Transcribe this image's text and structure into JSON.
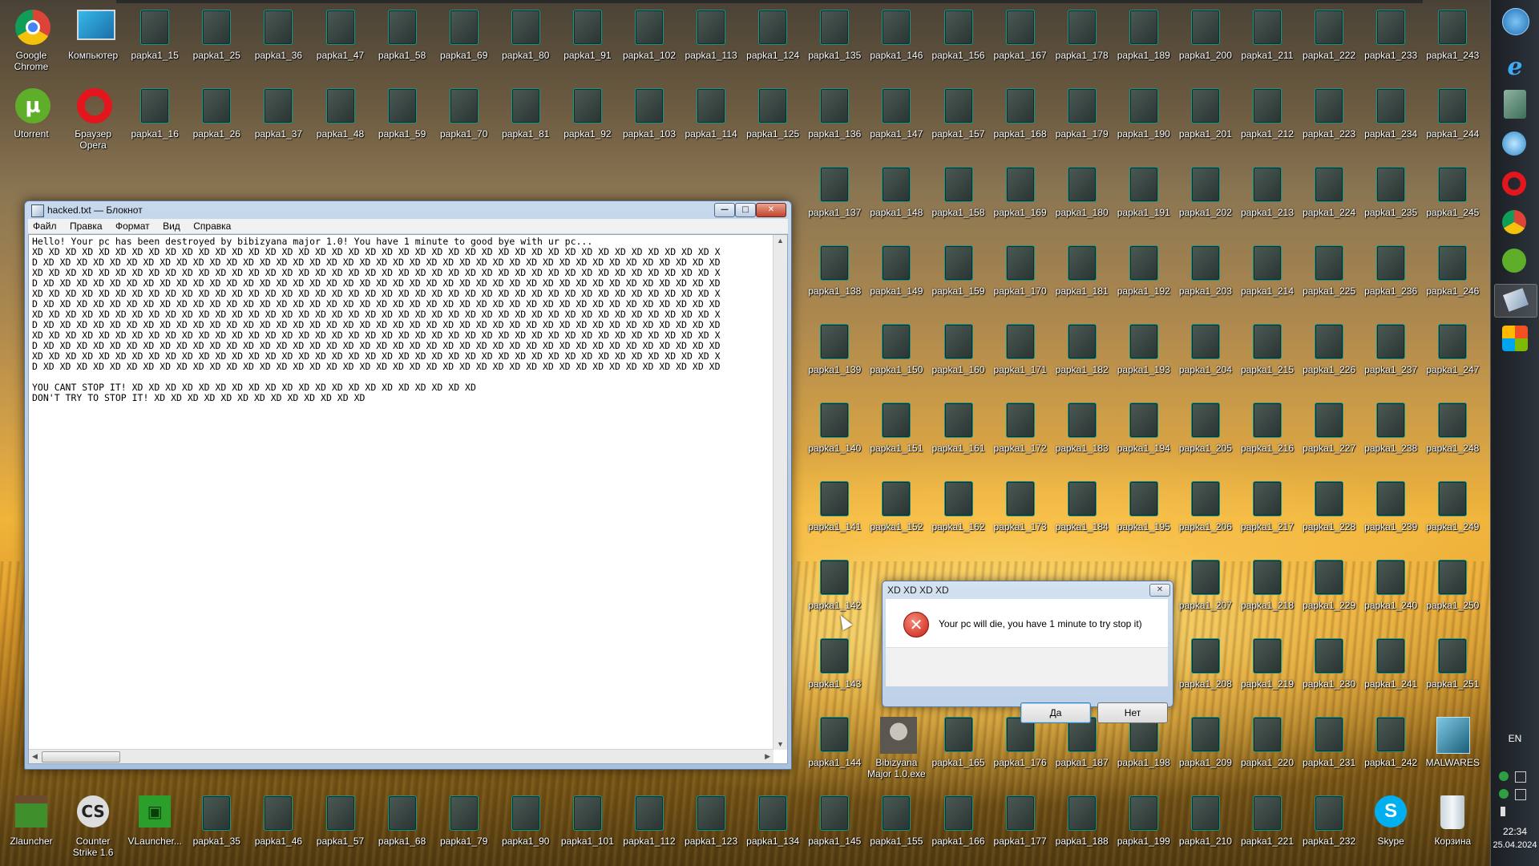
{
  "desktop": {
    "icons": [
      {
        "label": "Google Chrome",
        "icon": "chrome",
        "x": 0,
        "y": 0
      },
      {
        "label": "Компьютер",
        "icon": "monitor",
        "x": 1,
        "y": 0
      },
      {
        "label": "papka1_15",
        "icon": "folder",
        "x": 2,
        "y": 0
      },
      {
        "label": "papka1_25",
        "icon": "folder",
        "x": 3,
        "y": 0
      },
      {
        "label": "papka1_36",
        "icon": "folder",
        "x": 4,
        "y": 0
      },
      {
        "label": "papka1_47",
        "icon": "folder",
        "x": 5,
        "y": 0
      },
      {
        "label": "papka1_58",
        "icon": "folder",
        "x": 6,
        "y": 0
      },
      {
        "label": "papka1_69",
        "icon": "folder",
        "x": 7,
        "y": 0
      },
      {
        "label": "papka1_80",
        "icon": "folder",
        "x": 8,
        "y": 0
      },
      {
        "label": "papka1_91",
        "icon": "folder",
        "x": 9,
        "y": 0
      },
      {
        "label": "papka1_102",
        "icon": "folder",
        "x": 10,
        "y": 0
      },
      {
        "label": "papka1_113",
        "icon": "folder",
        "x": 11,
        "y": 0
      },
      {
        "label": "papka1_124",
        "icon": "folder",
        "x": 12,
        "y": 0
      },
      {
        "label": "papka1_135",
        "icon": "folder",
        "x": 13,
        "y": 0
      },
      {
        "label": "papka1_146",
        "icon": "folder",
        "x": 14,
        "y": 0
      },
      {
        "label": "papka1_156",
        "icon": "folder",
        "x": 15,
        "y": 0
      },
      {
        "label": "papka1_167",
        "icon": "folder",
        "x": 16,
        "y": 0
      },
      {
        "label": "papka1_178",
        "icon": "folder",
        "x": 17,
        "y": 0
      },
      {
        "label": "papka1_189",
        "icon": "folder",
        "x": 18,
        "y": 0
      },
      {
        "label": "papka1_200",
        "icon": "folder",
        "x": 19,
        "y": 0
      },
      {
        "label": "papka1_211",
        "icon": "folder",
        "x": 20,
        "y": 0
      },
      {
        "label": "papka1_222",
        "icon": "folder",
        "x": 21,
        "y": 0
      },
      {
        "label": "papka1_233",
        "icon": "folder",
        "x": 22,
        "y": 0
      },
      {
        "label": "papka1_243",
        "icon": "folder",
        "x": 23,
        "y": 0
      },
      {
        "label": "Utorrent",
        "icon": "utorrent",
        "x": 0,
        "y": 1
      },
      {
        "label": "Браузер Opera",
        "icon": "opera",
        "x": 1,
        "y": 1
      },
      {
        "label": "papka1_16",
        "icon": "folder",
        "x": 2,
        "y": 1
      },
      {
        "label": "papka1_26",
        "icon": "folder",
        "x": 3,
        "y": 1
      },
      {
        "label": "papka1_37",
        "icon": "folder",
        "x": 4,
        "y": 1
      },
      {
        "label": "papka1_48",
        "icon": "folder",
        "x": 5,
        "y": 1
      },
      {
        "label": "papka1_59",
        "icon": "folder",
        "x": 6,
        "y": 1
      },
      {
        "label": "papka1_70",
        "icon": "folder",
        "x": 7,
        "y": 1
      },
      {
        "label": "papka1_81",
        "icon": "folder",
        "x": 8,
        "y": 1
      },
      {
        "label": "papka1_92",
        "icon": "folder",
        "x": 9,
        "y": 1
      },
      {
        "label": "papka1_103",
        "icon": "folder",
        "x": 10,
        "y": 1
      },
      {
        "label": "papka1_114",
        "icon": "folder",
        "x": 11,
        "y": 1
      },
      {
        "label": "papka1_125",
        "icon": "folder",
        "x": 12,
        "y": 1
      },
      {
        "label": "papka1_136",
        "icon": "folder",
        "x": 13,
        "y": 1
      },
      {
        "label": "papka1_147",
        "icon": "folder",
        "x": 14,
        "y": 1
      },
      {
        "label": "papka1_157",
        "icon": "folder",
        "x": 15,
        "y": 1
      },
      {
        "label": "papka1_168",
        "icon": "folder",
        "x": 16,
        "y": 1
      },
      {
        "label": "papka1_179",
        "icon": "folder",
        "x": 17,
        "y": 1
      },
      {
        "label": "papka1_190",
        "icon": "folder",
        "x": 18,
        "y": 1
      },
      {
        "label": "papka1_201",
        "icon": "folder",
        "x": 19,
        "y": 1
      },
      {
        "label": "papka1_212",
        "icon": "folder",
        "x": 20,
        "y": 1
      },
      {
        "label": "papka1_223",
        "icon": "folder",
        "x": 21,
        "y": 1
      },
      {
        "label": "papka1_234",
        "icon": "folder",
        "x": 22,
        "y": 1
      },
      {
        "label": "papka1_244",
        "icon": "folder",
        "x": 23,
        "y": 1
      },
      {
        "label": "papka1_137",
        "icon": "folder",
        "x": 13,
        "y": 2
      },
      {
        "label": "papka1_148",
        "icon": "folder",
        "x": 14,
        "y": 2
      },
      {
        "label": "papka1_158",
        "icon": "folder",
        "x": 15,
        "y": 2
      },
      {
        "label": "papka1_169",
        "icon": "folder",
        "x": 16,
        "y": 2
      },
      {
        "label": "papka1_180",
        "icon": "folder",
        "x": 17,
        "y": 2
      },
      {
        "label": "papka1_191",
        "icon": "folder",
        "x": 18,
        "y": 2
      },
      {
        "label": "papka1_202",
        "icon": "folder",
        "x": 19,
        "y": 2
      },
      {
        "label": "papka1_213",
        "icon": "folder",
        "x": 20,
        "y": 2
      },
      {
        "label": "papka1_224",
        "icon": "folder",
        "x": 21,
        "y": 2
      },
      {
        "label": "papka1_235",
        "icon": "folder",
        "x": 22,
        "y": 2
      },
      {
        "label": "papka1_245",
        "icon": "folder",
        "x": 23,
        "y": 2
      },
      {
        "label": "papka1_138",
        "icon": "folder",
        "x": 13,
        "y": 3
      },
      {
        "label": "papka1_149",
        "icon": "folder",
        "x": 14,
        "y": 3
      },
      {
        "label": "papka1_159",
        "icon": "folder",
        "x": 15,
        "y": 3
      },
      {
        "label": "papka1_170",
        "icon": "folder",
        "x": 16,
        "y": 3
      },
      {
        "label": "papka1_181",
        "icon": "folder",
        "x": 17,
        "y": 3
      },
      {
        "label": "papka1_192",
        "icon": "folder",
        "x": 18,
        "y": 3
      },
      {
        "label": "papka1_203",
        "icon": "folder",
        "x": 19,
        "y": 3
      },
      {
        "label": "papka1_214",
        "icon": "folder",
        "x": 20,
        "y": 3
      },
      {
        "label": "papka1_225",
        "icon": "folder",
        "x": 21,
        "y": 3
      },
      {
        "label": "papka1_236",
        "icon": "folder",
        "x": 22,
        "y": 3
      },
      {
        "label": "papka1_246",
        "icon": "folder",
        "x": 23,
        "y": 3
      },
      {
        "label": "papka1_139",
        "icon": "folder",
        "x": 13,
        "y": 4
      },
      {
        "label": "papka1_150",
        "icon": "folder",
        "x": 14,
        "y": 4
      },
      {
        "label": "papka1_160",
        "icon": "folder",
        "x": 15,
        "y": 4
      },
      {
        "label": "papka1_171",
        "icon": "folder",
        "x": 16,
        "y": 4
      },
      {
        "label": "papka1_182",
        "icon": "folder",
        "x": 17,
        "y": 4
      },
      {
        "label": "papka1_193",
        "icon": "folder",
        "x": 18,
        "y": 4
      },
      {
        "label": "papka1_204",
        "icon": "folder",
        "x": 19,
        "y": 4
      },
      {
        "label": "papka1_215",
        "icon": "folder",
        "x": 20,
        "y": 4
      },
      {
        "label": "papka1_226",
        "icon": "folder",
        "x": 21,
        "y": 4
      },
      {
        "label": "papka1_237",
        "icon": "folder",
        "x": 22,
        "y": 4
      },
      {
        "label": "papka1_247",
        "icon": "folder",
        "x": 23,
        "y": 4
      },
      {
        "label": "papka1_140",
        "icon": "folder",
        "x": 13,
        "y": 5
      },
      {
        "label": "papka1_151",
        "icon": "folder",
        "x": 14,
        "y": 5
      },
      {
        "label": "papka1_161",
        "icon": "folder",
        "x": 15,
        "y": 5
      },
      {
        "label": "papka1_172",
        "icon": "folder",
        "x": 16,
        "y": 5
      },
      {
        "label": "papka1_183",
        "icon": "folder",
        "x": 17,
        "y": 5
      },
      {
        "label": "papka1_194",
        "icon": "folder",
        "x": 18,
        "y": 5
      },
      {
        "label": "papka1_205",
        "icon": "folder",
        "x": 19,
        "y": 5
      },
      {
        "label": "papka1_216",
        "icon": "folder",
        "x": 20,
        "y": 5
      },
      {
        "label": "papka1_227",
        "icon": "folder",
        "x": 21,
        "y": 5
      },
      {
        "label": "papka1_238",
        "icon": "folder",
        "x": 22,
        "y": 5
      },
      {
        "label": "papka1_248",
        "icon": "folder",
        "x": 23,
        "y": 5
      },
      {
        "label": "papka1_141",
        "icon": "folder",
        "x": 13,
        "y": 6
      },
      {
        "label": "papka1_152",
        "icon": "folder",
        "x": 14,
        "y": 6
      },
      {
        "label": "papka1_162",
        "icon": "folder",
        "x": 15,
        "y": 6
      },
      {
        "label": "papka1_173",
        "icon": "folder",
        "x": 16,
        "y": 6
      },
      {
        "label": "papka1_184",
        "icon": "folder",
        "x": 17,
        "y": 6
      },
      {
        "label": "papka1_195",
        "icon": "folder",
        "x": 18,
        "y": 6
      },
      {
        "label": "papka1_206",
        "icon": "folder",
        "x": 19,
        "y": 6
      },
      {
        "label": "papka1_217",
        "icon": "folder",
        "x": 20,
        "y": 6
      },
      {
        "label": "papka1_228",
        "icon": "folder",
        "x": 21,
        "y": 6
      },
      {
        "label": "papka1_239",
        "icon": "folder",
        "x": 22,
        "y": 6
      },
      {
        "label": "papka1_249",
        "icon": "folder",
        "x": 23,
        "y": 6
      },
      {
        "label": "papka1_142",
        "icon": "folder",
        "x": 13,
        "y": 7
      },
      {
        "label": "papka1_207",
        "icon": "folder",
        "x": 19,
        "y": 7
      },
      {
        "label": "papka1_218",
        "icon": "folder",
        "x": 20,
        "y": 7
      },
      {
        "label": "papka1_229",
        "icon": "folder",
        "x": 21,
        "y": 7
      },
      {
        "label": "papka1_240",
        "icon": "folder",
        "x": 22,
        "y": 7
      },
      {
        "label": "papka1_250",
        "icon": "folder",
        "x": 23,
        "y": 7
      },
      {
        "label": "papka1_143",
        "icon": "folder",
        "x": 13,
        "y": 8
      },
      {
        "label": "papka1_208",
        "icon": "folder",
        "x": 19,
        "y": 8
      },
      {
        "label": "papka1_219",
        "icon": "folder",
        "x": 20,
        "y": 8
      },
      {
        "label": "papka1_230",
        "icon": "folder",
        "x": 21,
        "y": 8
      },
      {
        "label": "papka1_241",
        "icon": "folder",
        "x": 22,
        "y": 8
      },
      {
        "label": "papka1_251",
        "icon": "folder",
        "x": 23,
        "y": 8
      },
      {
        "label": "papka1_144",
        "icon": "folder",
        "x": 13,
        "y": 9
      },
      {
        "label": "Bibizyana Major 1.0.exe",
        "icon": "person",
        "x": 14,
        "y": 9
      },
      {
        "label": "papka1_165",
        "icon": "folder",
        "x": 15,
        "y": 9
      },
      {
        "label": "papka1_176",
        "icon": "folder",
        "x": 16,
        "y": 9
      },
      {
        "label": "papka1_187",
        "icon": "folder",
        "x": 17,
        "y": 9
      },
      {
        "label": "papka1_198",
        "icon": "folder",
        "x": 18,
        "y": 9
      },
      {
        "label": "papka1_209",
        "icon": "folder",
        "x": 19,
        "y": 9
      },
      {
        "label": "papka1_220",
        "icon": "folder",
        "x": 20,
        "y": 9
      },
      {
        "label": "papka1_231",
        "icon": "folder",
        "x": 21,
        "y": 9
      },
      {
        "label": "papka1_242",
        "icon": "folder",
        "x": 22,
        "y": 9
      },
      {
        "label": "MALWARES",
        "icon": "malwares",
        "x": 23,
        "y": 9
      },
      {
        "label": "Zlauncher",
        "icon": "minecraft",
        "x": 0,
        "y": 10
      },
      {
        "label": "Counter Strike 1.6",
        "icon": "counterstrike",
        "x": 1,
        "y": 10
      },
      {
        "label": "VLauncher...",
        "icon": "vlauncher",
        "x": 2,
        "y": 10
      },
      {
        "label": "papka1_35",
        "icon": "folder",
        "x": 3,
        "y": 10
      },
      {
        "label": "papka1_46",
        "icon": "folder",
        "x": 4,
        "y": 10
      },
      {
        "label": "papka1_57",
        "icon": "folder",
        "x": 5,
        "y": 10
      },
      {
        "label": "papka1_68",
        "icon": "folder",
        "x": 6,
        "y": 10
      },
      {
        "label": "papka1_79",
        "icon": "folder",
        "x": 7,
        "y": 10
      },
      {
        "label": "papka1_90",
        "icon": "folder",
        "x": 8,
        "y": 10
      },
      {
        "label": "papka1_101",
        "icon": "folder",
        "x": 9,
        "y": 10
      },
      {
        "label": "papka1_112",
        "icon": "folder",
        "x": 10,
        "y": 10
      },
      {
        "label": "papka1_123",
        "icon": "folder",
        "x": 11,
        "y": 10
      },
      {
        "label": "papka1_134",
        "icon": "folder",
        "x": 12,
        "y": 10
      },
      {
        "label": "papka1_145",
        "icon": "folder",
        "x": 13,
        "y": 10
      },
      {
        "label": "papka1_155",
        "icon": "folder",
        "x": 14,
        "y": 10
      },
      {
        "label": "papka1_166",
        "icon": "folder",
        "x": 15,
        "y": 10
      },
      {
        "label": "papka1_177",
        "icon": "folder",
        "x": 16,
        "y": 10
      },
      {
        "label": "papka1_188",
        "icon": "folder",
        "x": 17,
        "y": 10
      },
      {
        "label": "papka1_199",
        "icon": "folder",
        "x": 18,
        "y": 10
      },
      {
        "label": "papka1_210",
        "icon": "folder",
        "x": 19,
        "y": 10
      },
      {
        "label": "papka1_221",
        "icon": "folder",
        "x": 20,
        "y": 10
      },
      {
        "label": "papka1_232",
        "icon": "folder",
        "x": 21,
        "y": 10
      },
      {
        "label": "Skype",
        "icon": "skype",
        "x": 22,
        "y": 10
      },
      {
        "label": "Корзина",
        "icon": "recycle-bin",
        "x": 23,
        "y": 10
      }
    ]
  },
  "notepad": {
    "title": "hacked.txt — Блокнот",
    "menu": [
      "Файл",
      "Правка",
      "Формат",
      "Вид",
      "Справка"
    ],
    "content": "Hello! Your pc has been destroyed by bibizyana major 1.0! You have 1 minute to good bye with ur pc...\nXD XD XD XD XD XD XD XD XD XD XD XD XD XD XD XD XD XD XD XD XD XD XD XD XD XD XD XD XD XD XD XD XD XD XD XD XD XD XD XD XD X\nD XD XD XD XD XD XD XD XD XD XD XD XD XD XD XD XD XD XD XD XD XD XD XD XD XD XD XD XD XD XD XD XD XD XD XD XD XD XD XD XD XD\nXD XD XD XD XD XD XD XD XD XD XD XD XD XD XD XD XD XD XD XD XD XD XD XD XD XD XD XD XD XD XD XD XD XD XD XD XD XD XD XD XD X\nD XD XD XD XD XD XD XD XD XD XD XD XD XD XD XD XD XD XD XD XD XD XD XD XD XD XD XD XD XD XD XD XD XD XD XD XD XD XD XD XD XD\nXD XD XD XD XD XD XD XD XD XD XD XD XD XD XD XD XD XD XD XD XD XD XD XD XD XD XD XD XD XD XD XD XD XD XD XD XD XD XD XD XD X\nD XD XD XD XD XD XD XD XD XD XD XD XD XD XD XD XD XD XD XD XD XD XD XD XD XD XD XD XD XD XD XD XD XD XD XD XD XD XD XD XD XD\nXD XD XD XD XD XD XD XD XD XD XD XD XD XD XD XD XD XD XD XD XD XD XD XD XD XD XD XD XD XD XD XD XD XD XD XD XD XD XD XD XD X\nD XD XD XD XD XD XD XD XD XD XD XD XD XD XD XD XD XD XD XD XD XD XD XD XD XD XD XD XD XD XD XD XD XD XD XD XD XD XD XD XD XD\nXD XD XD XD XD XD XD XD XD XD XD XD XD XD XD XD XD XD XD XD XD XD XD XD XD XD XD XD XD XD XD XD XD XD XD XD XD XD XD XD XD X\nD XD XD XD XD XD XD XD XD XD XD XD XD XD XD XD XD XD XD XD XD XD XD XD XD XD XD XD XD XD XD XD XD XD XD XD XD XD XD XD XD XD\nXD XD XD XD XD XD XD XD XD XD XD XD XD XD XD XD XD XD XD XD XD XD XD XD XD XD XD XD XD XD XD XD XD XD XD XD XD XD XD XD XD X\nD XD XD XD XD XD XD XD XD XD XD XD XD XD XD XD XD XD XD XD XD XD XD XD XD XD XD XD XD XD XD XD XD XD XD XD XD XD XD XD XD XD\n\nYOU CANT STOP IT! XD XD XD XD XD XD XD XD XD XD XD XD XD XD XD XD XD XD XD XD XD\nDON'T TRY TO STOP IT! XD XD XD XD XD XD XD XD XD XD XD XD XD"
  },
  "dialog": {
    "title": "XD XD XD XD",
    "message": "Your pc will die, you have 1 minute to try stop it)",
    "yes": "Да",
    "no": "Нет",
    "close": "✕",
    "icon": "error-icon"
  },
  "taskbar": {
    "language": "EN",
    "time": "22:34",
    "date": "25.04.2024"
  }
}
